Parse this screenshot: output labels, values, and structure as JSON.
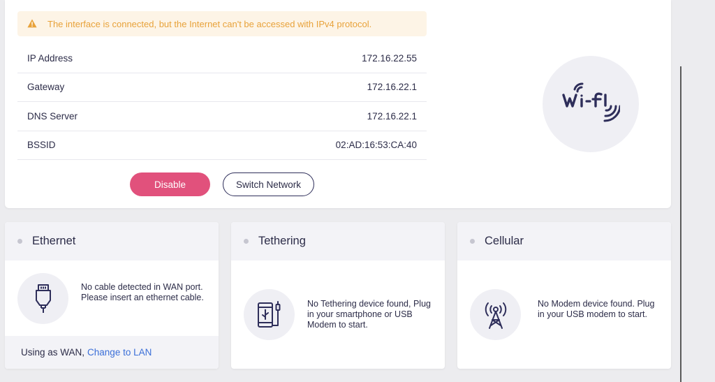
{
  "alert": {
    "message": "The interface is connected, but the Internet can't be accessed with IPv4 protocol.",
    "icon": "warning-icon",
    "color": "#e8a23a"
  },
  "info": [
    {
      "label": "IP Address",
      "value": "172.16.22.55"
    },
    {
      "label": "Gateway",
      "value": "172.16.22.1"
    },
    {
      "label": "DNS Server",
      "value": "172.16.22.1"
    },
    {
      "label": "BSSID",
      "value": "02:AD:16:53:CA:40"
    }
  ],
  "buttons": {
    "disable": "Disable",
    "switch_network": "Switch Network"
  },
  "wifi_icon": "wifi-logo-icon",
  "colors": {
    "accent": "#e1517c",
    "link": "#3b6fd8",
    "text": "#2c2c48"
  },
  "panels": {
    "ethernet": {
      "title": "Ethernet",
      "icon": "ethernet-plug-icon",
      "message": "No cable detected in WAN port. Please insert an ethernet cable.",
      "footer_text": "Using as WAN,",
      "footer_link": "Change to LAN"
    },
    "tethering": {
      "title": "Tethering",
      "icon": "phone-usb-icon",
      "message": "No Tethering device found, Plug in your smartphone or USB Modem to start."
    },
    "cellular": {
      "title": "Cellular",
      "icon": "cell-tower-icon",
      "message": "No Modem device found. Plug in your USB modem to start."
    }
  }
}
